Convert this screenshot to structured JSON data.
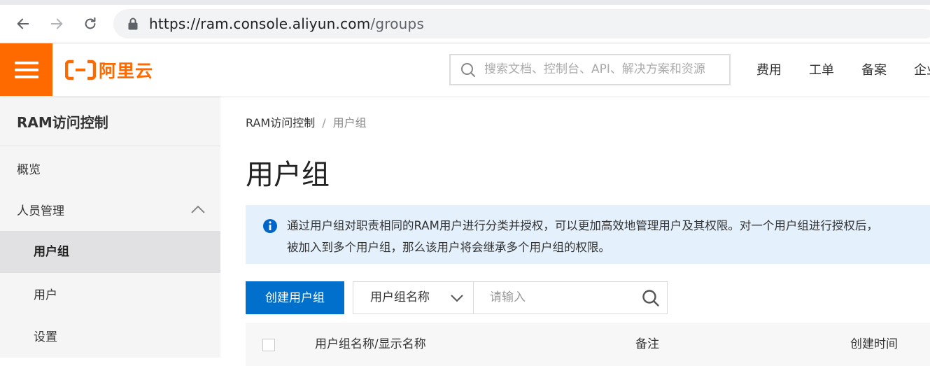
{
  "browser": {
    "url_host": "https://ram.console.aliyun.com",
    "url_path": "/groups"
  },
  "header": {
    "logo_text": "阿里云",
    "search_placeholder": "搜索文档、控制台、API、解决方案和资源",
    "links": [
      "费用",
      "工单",
      "备案",
      "企业"
    ]
  },
  "sidebar": {
    "title": "RAM访问控制",
    "items": [
      {
        "label": "概览"
      },
      {
        "label": "人员管理"
      },
      {
        "label": "用户组"
      },
      {
        "label": "用户"
      },
      {
        "label": "设置"
      }
    ]
  },
  "main": {
    "breadcrumb": [
      "RAM访问控制",
      "/",
      "用户组"
    ],
    "title": "用户组",
    "notice_line1": "通过用户组对职责相同的RAM用户进行分类并授权，可以更加高效地管理用户及其权限。对一个用户组进行授权后，",
    "notice_line2": "被加入到多个用户组，那么该用户将会继承多个用户组的权限。",
    "create_button": "创建用户组",
    "filter_select": "用户组名称",
    "filter_placeholder": "请输入",
    "columns": [
      "用户组名称/显示名称",
      "备注",
      "创建时间"
    ]
  },
  "colors": {
    "brand": "#ff6a00",
    "primary": "#0070cc",
    "notice_bg": "#e4f1fd"
  }
}
